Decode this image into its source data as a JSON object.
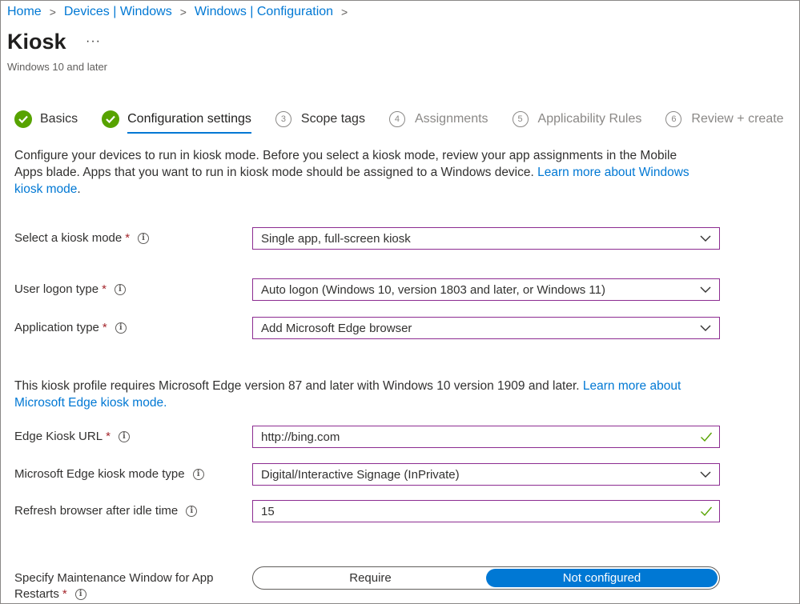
{
  "breadcrumb": [
    "Home",
    "Devices | Windows",
    "Windows | Configuration"
  ],
  "page": {
    "title": "Kiosk",
    "more": "···",
    "subtitle": "Windows 10 and later"
  },
  "steps": [
    {
      "label": "Basics",
      "state": "done"
    },
    {
      "label": "Configuration settings",
      "state": "active"
    },
    {
      "number": "3",
      "label": "Scope tags",
      "state": "pending-dark"
    },
    {
      "number": "4",
      "label": "Assignments",
      "state": "pending"
    },
    {
      "number": "5",
      "label": "Applicability Rules",
      "state": "pending"
    },
    {
      "number": "6",
      "label": "Review + create",
      "state": "pending"
    }
  ],
  "intro": {
    "text": "Configure your devices to run in kiosk mode. Before you select a kiosk mode, review your app assignments in the Mobile Apps blade. Apps that you want to run in kiosk mode should be assigned to a Windows device. ",
    "link": "Learn more about Windows kiosk mode",
    "end": "."
  },
  "edge_note": {
    "text": "This kiosk profile requires Microsoft Edge version 87 and later with Windows 10 version 1909 and later. ",
    "link": "Learn more about Microsoft Edge kiosk mode."
  },
  "fields": {
    "kiosk_mode": {
      "label": "Select a kiosk mode",
      "required": "*",
      "value": "Single app, full-screen kiosk"
    },
    "logon_type": {
      "label": "User logon type",
      "required": "*",
      "value": "Auto logon (Windows 10, version 1803 and later, or Windows 11)"
    },
    "app_type": {
      "label": "Application type",
      "required": "*",
      "value": "Add Microsoft Edge browser"
    },
    "edge_url": {
      "label": "Edge Kiosk URL",
      "required": "*",
      "value": "http://bing.com"
    },
    "edge_mode_type": {
      "label": "Microsoft Edge kiosk mode type",
      "value": "Digital/Interactive Signage (InPrivate)"
    },
    "refresh_idle": {
      "label": "Refresh browser after idle time",
      "value": "15"
    },
    "maintenance": {
      "label_line1": "Specify Maintenance Window for App",
      "label_line2": "Restarts",
      "required": "*",
      "options": [
        "Require",
        "Not configured"
      ],
      "selected": "Not configured"
    }
  },
  "info_glyph": "i",
  "colors": {
    "link": "#0078d4",
    "check_green": "#57a300",
    "field_border": "#8c2c91",
    "required": "#a4262c",
    "toggle_selected": "#0078d4"
  }
}
